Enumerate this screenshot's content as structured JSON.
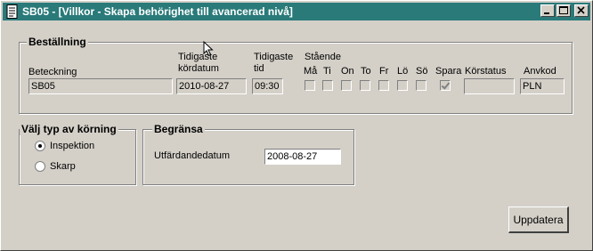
{
  "window": {
    "title": "SB05 - [Villkor - Skapa behörighet till avancerad nivå]",
    "icon": "document-icon"
  },
  "order": {
    "legend": "Beställning",
    "labels": {
      "designation": "Beteckning",
      "earliest_date_line1": "Tidigaste",
      "earliest_date_line2": "kördatum",
      "earliest_time_line1": "Tidigaste",
      "earliest_time_line2": "tid",
      "standing": "Stående",
      "run_status": "Körstatus",
      "user_code": "Anvkod"
    },
    "values": {
      "designation": "SB05",
      "earliest_date": "2010-08-27",
      "earliest_time": "09:30",
      "run_status": "",
      "user_code": "PLN"
    },
    "days": [
      {
        "label": "Må",
        "checked": false
      },
      {
        "label": "Ti",
        "checked": false
      },
      {
        "label": "On",
        "checked": false
      },
      {
        "label": "To",
        "checked": false
      },
      {
        "label": "Fr",
        "checked": false
      },
      {
        "label": "Lö",
        "checked": false
      },
      {
        "label": "Sö",
        "checked": false
      },
      {
        "label": "Spara",
        "checked": true
      }
    ]
  },
  "run_type": {
    "legend": "Välj typ av körning",
    "options": [
      {
        "label": "Inspektion",
        "selected": true
      },
      {
        "label": "Skarp",
        "selected": false
      }
    ]
  },
  "limit": {
    "legend": "Begränsa",
    "issue_date_label": "Utfärdandedatum",
    "issue_date_value": "2008-08-27"
  },
  "update_button": "Uppdatera"
}
